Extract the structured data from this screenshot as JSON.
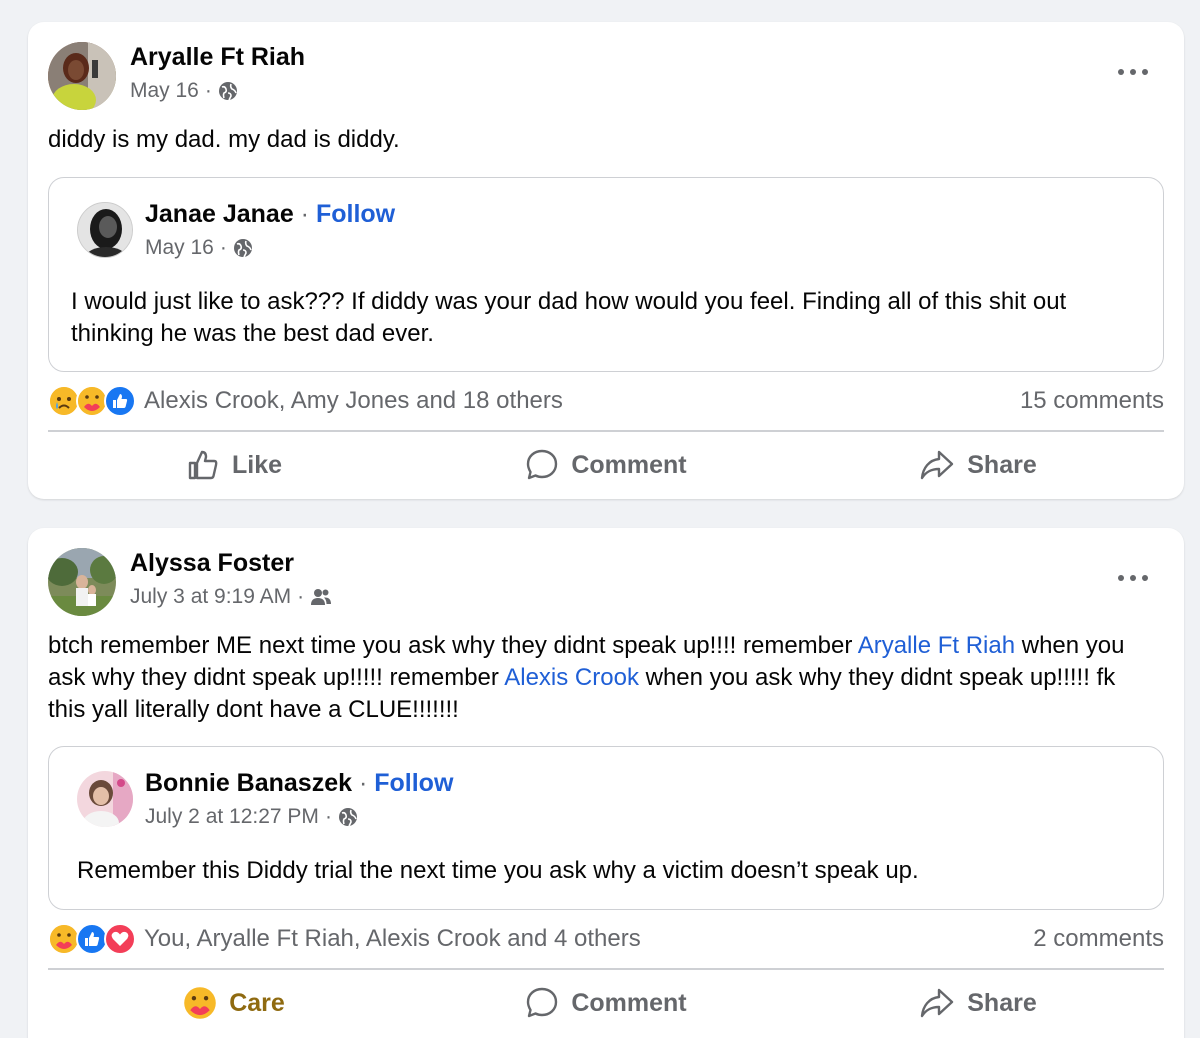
{
  "posts": [
    {
      "author": "Aryalle Ft Riah",
      "date": "May 16",
      "separator": "·",
      "privacy_icon": "globe-icon",
      "text": "diddy is my dad. my dad is diddy.",
      "shared": {
        "author": "Janae Janae",
        "follow_sep": "·",
        "follow": "Follow",
        "date": "May 16",
        "separator": "·",
        "privacy_icon": "globe-icon",
        "text": "I would just like to ask??? If diddy was your dad how would you feel. Finding all of this shit out thinking he was the best dad ever."
      },
      "reaction_icons": [
        "sad-reaction-icon",
        "care-reaction-icon",
        "like-reaction-icon"
      ],
      "reaction_names": "Alexis Crook, Amy Jones and 18 others",
      "comments": "15 comments",
      "actions": {
        "first": "Like",
        "comment": "Comment",
        "share": "Share"
      }
    },
    {
      "author": "Alyssa Foster",
      "date": "July 3 at 9:19 AM",
      "separator": "·",
      "privacy_icon": "friends-icon",
      "text_parts": {
        "p1": "btch remember ME next time you ask why they didnt speak up!!!! remember ",
        "m1": "Aryalle Ft Riah",
        "p2": " when you ask why they didnt speak up!!!!! remember ",
        "m2": "Alexis Crook",
        "p3": " when you ask why they didnt speak up!!!!! fk this yall literally dont have a CLUE!!!!!!!"
      },
      "shared": {
        "author": "Bonnie Banaszek",
        "follow_sep": "·",
        "follow": "Follow",
        "date": "July 2 at 12:27 PM",
        "separator": "·",
        "privacy_icon": "globe-icon",
        "text": "Remember this Diddy trial the next time you ask why a victim doesn’t speak up."
      },
      "reaction_icons": [
        "care-reaction-icon",
        "like-reaction-icon",
        "love-reaction-icon"
      ],
      "reaction_names": "You, Aryalle Ft Riah, Alexis Crook and 4 others",
      "comments": "2 comments",
      "actions": {
        "first": "Care",
        "comment": "Comment",
        "share": "Share"
      }
    }
  ],
  "colors": {
    "background": "#f0f2f5",
    "card": "#ffffff",
    "link_blue": "#1f5fd6",
    "secondary_text": "#65676b",
    "care_gold": "#8f6a10",
    "like_blue": "#1877f2",
    "love_red": "#f33e58"
  }
}
